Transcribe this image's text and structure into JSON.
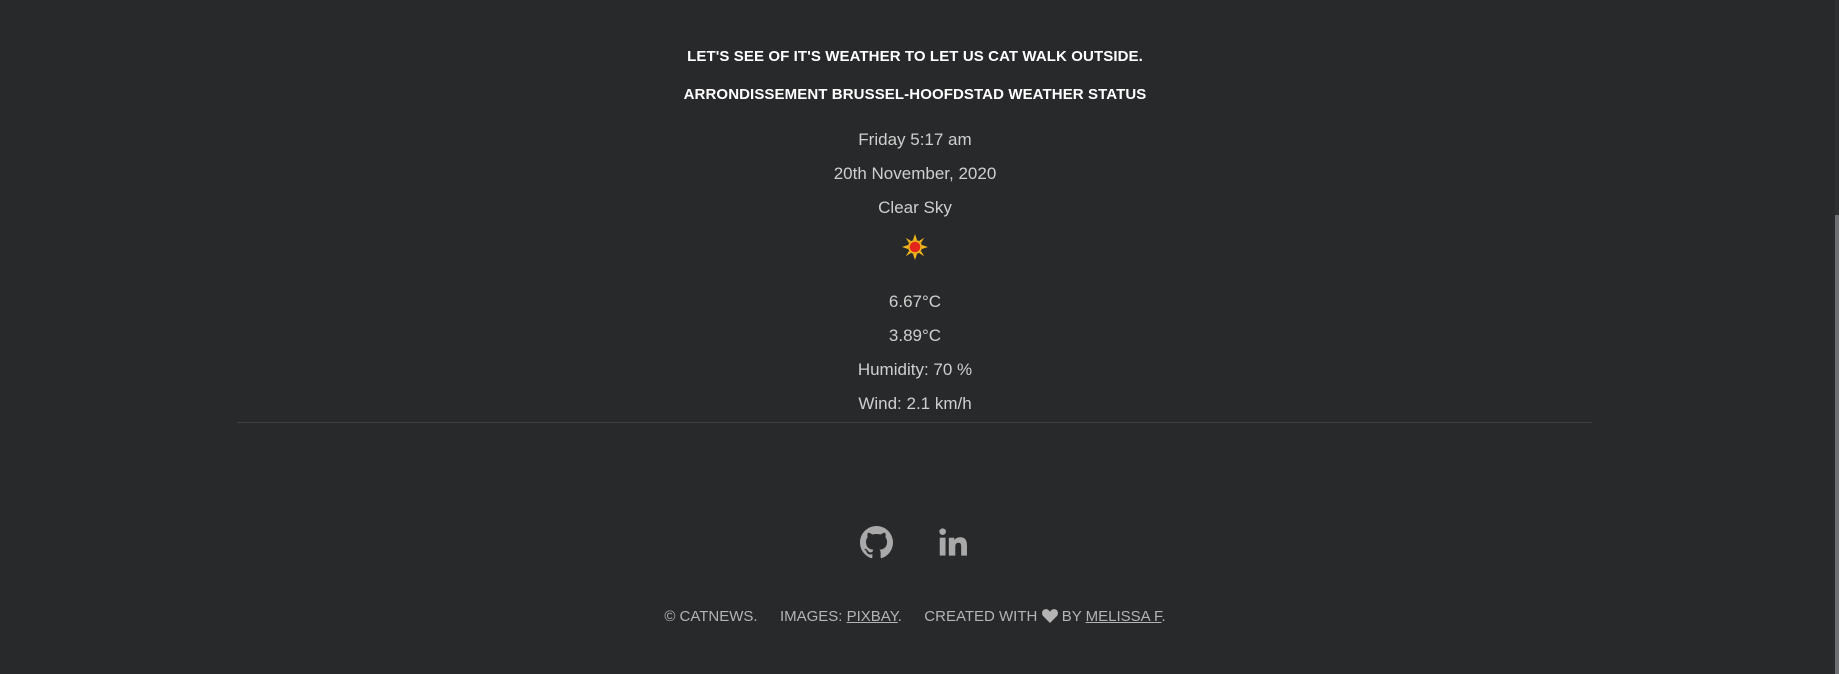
{
  "weather": {
    "tagline": "LET'S SEE OF IT'S WEATHER TO LET US CAT WALK OUTSIDE.",
    "location_title": "ARRONDISSEMENT BRUSSEL-HOOFDSTAD WEATHER STATUS",
    "day_time": "Friday 5:17 am",
    "date": "20th November, 2020",
    "condition": "Clear Sky",
    "condition_icon": "sun-icon",
    "temperature": "6.67°C",
    "feels_like": "3.89°C",
    "humidity": "Humidity: 70 %",
    "wind": "Wind: 2.1 km/h"
  },
  "social": {
    "github_icon": "github-icon",
    "linkedin_icon": "linkedin-icon"
  },
  "footer": {
    "copyright": "© CATNEWS.",
    "images_prefix": "IMAGES:",
    "images_link": "PIXBAY",
    "period1": ".",
    "created_prefix": "CREATED WITH",
    "heart_icon": "heart-icon",
    "by_text": "BY",
    "author_link": "MELISSA F",
    "period2": "."
  },
  "colors": {
    "background": "#28292b",
    "heading": "#ffffff",
    "text": "#cfcfcf",
    "icon": "#a9a9a9"
  }
}
